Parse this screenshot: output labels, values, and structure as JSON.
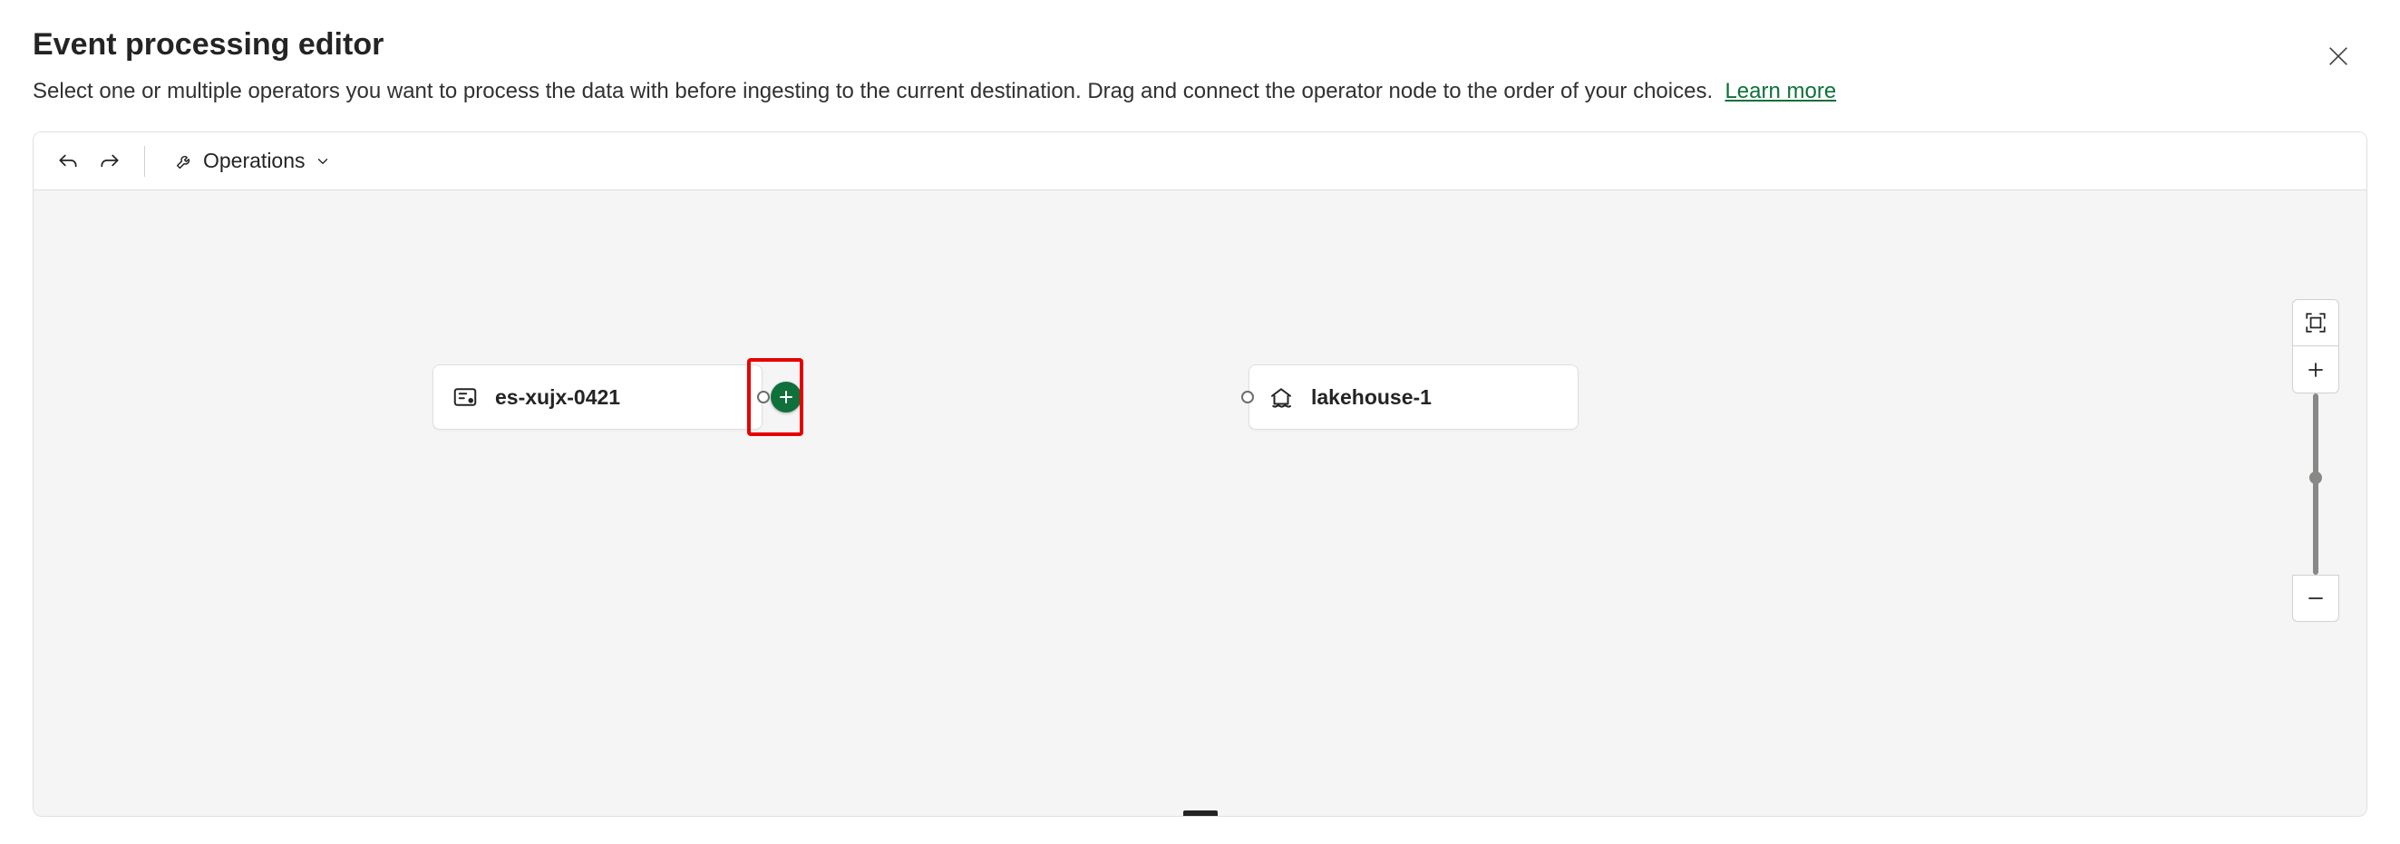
{
  "header": {
    "title": "Event processing editor",
    "subtitle": "Select one or multiple operators you want to process the data with before ingesting to the current destination. Drag and connect the operator node to the order of your choices.",
    "learn_more_label": "Learn more"
  },
  "toolbar": {
    "operations_label": "Operations"
  },
  "canvas": {
    "nodes": [
      {
        "label": "es-xujx-0421",
        "icon": "eventstream-icon"
      },
      {
        "label": "lakehouse-1",
        "icon": "lakehouse-icon"
      }
    ]
  },
  "colors": {
    "accent": "#0f703b",
    "highlight": "#e60000"
  }
}
